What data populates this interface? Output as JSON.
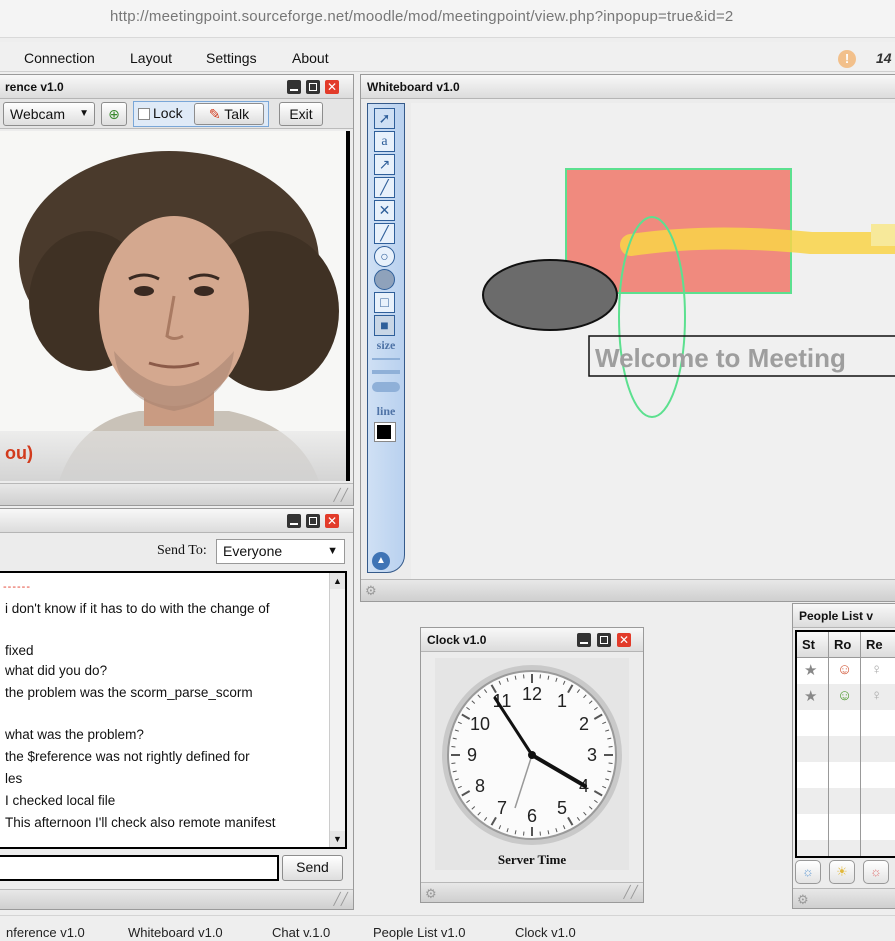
{
  "browser": {
    "url": "http://meetingpoint.sourceforge.net/moodle/mod/meetingpoint/view.php?inpopup=true&id=2"
  },
  "menu": {
    "items": [
      "Connection",
      "Layout",
      "Settings",
      "About"
    ],
    "right_number": "14"
  },
  "conference": {
    "title": "rence v1.0",
    "camera_select": "Webcam",
    "lock_label": "Lock",
    "talk_label": "Talk",
    "exit_label": "Exit",
    "caption": "ou)"
  },
  "chat": {
    "send_to_label": "Send To:",
    "send_to_value": "Everyone",
    "divider": "------",
    "messages": [
      "i don't know if it has to do with the change of",
      "fixed",
      "what did you do?",
      "the problem was the scorm_parse_scorm",
      "what was the problem?",
      "the $reference was not rightly defined for",
      "les",
      "I checked local file",
      "This afternoon I'll check also remote manifest"
    ],
    "send_label": "Send"
  },
  "whiteboard": {
    "title": "Whiteboard v1.0",
    "tools": {
      "text_tool": "a",
      "size_label": "size",
      "line_label": "line"
    },
    "canvas_text": "Welcome to Meeting",
    "colors": {
      "rect_fill": "#f08a7e",
      "rect_stroke": "#5ce08f",
      "ellipse_fill": "#6b6b6b",
      "yellow_stroke": "#f9d348",
      "green_ellipse": "#5ce08f"
    }
  },
  "clock": {
    "title": "Clock v1.0",
    "numbers": [
      "12",
      "1",
      "2",
      "3",
      "4",
      "5",
      "6",
      "7",
      "8",
      "9",
      "10",
      "11"
    ],
    "label": "Server Time"
  },
  "people": {
    "title": "People List v",
    "columns": [
      "St",
      "Ro",
      "Re"
    ]
  },
  "taskbar": {
    "items": [
      "nference v1.0",
      "Whiteboard v1.0",
      "Chat v.1.0",
      "People List v1.0",
      "Clock v1.0"
    ]
  }
}
